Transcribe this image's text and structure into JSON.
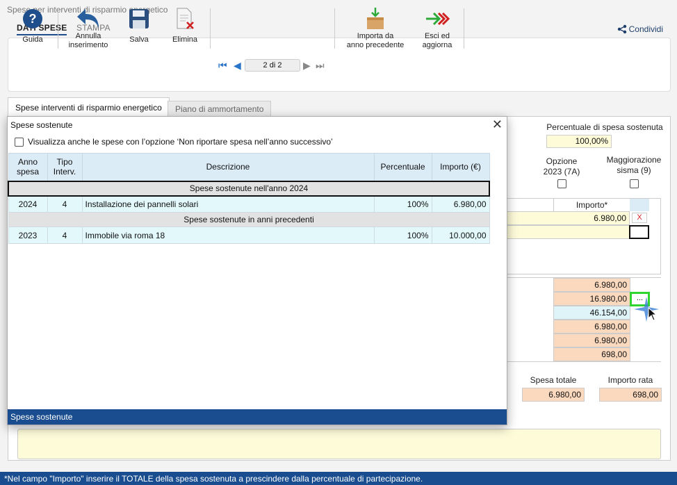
{
  "window_title": "Spese per interventi di risparmio energetico",
  "tabs": {
    "active": "DATI SPESE",
    "inactive": "STAMPA"
  },
  "share_label": "Condividi",
  "toolbar": {
    "guida": "Guida",
    "annulla_1": "Annulla",
    "annulla_2": "inserimento",
    "salva": "Salva",
    "elimina": "Elimina",
    "record_nav": "2 di 2",
    "importa_1": "Importa da",
    "importa_2": "anno precedente",
    "esci_1": "Esci ed",
    "esci_2": "aggiorna"
  },
  "panel_tabs": {
    "active": "Spese interventi di risparmio energetico",
    "inactive": "Piano di ammortamento"
  },
  "right": {
    "perc_label": "Percentuale di spesa sostenuta",
    "perc_value": "100,00%",
    "opzione_1": "Opzione",
    "opzione_2": "2023 (7A)",
    "magg_1": "Maggiorazione",
    "magg_2": "sisma (9)",
    "importo_header": "Importo*",
    "importo_value": "6.980,00",
    "delete_label": "X",
    "dots_label": "...",
    "values": [
      "6.980,00",
      "16.980,00",
      "46.154,00",
      "6.980,00",
      "6.980,00",
      "698,00"
    ],
    "spesa_totale_label": "Spesa totale",
    "spesa_totale_value": "6.980,00",
    "importo_rata_label": "Importo rata",
    "importo_rata_value": "698,00"
  },
  "footer_note": "*Nel campo \"Importo\" inserire il TOTALE della spesa sostenuta a prescindere dalla percentuale di partecipazione.",
  "modal": {
    "title": "Spese sostenute",
    "option_label": "Visualizza anche le spese con l’opzione ‘Non riportare spesa nell’anno successivo’",
    "columns": [
      "Anno spesa",
      "Tipo Interv.",
      "Descrizione",
      "Percentuale",
      "Importo (€)"
    ],
    "group_current": "Spese sostenute nell'anno 2024",
    "row_current": {
      "anno": "2024",
      "tipo": "4",
      "descr": "Installazione dei pannelli solari",
      "perc": "100%",
      "importo": "6.980,00"
    },
    "group_prev": "Spese sostenute in anni precedenti",
    "row_prev": {
      "anno": "2023",
      "tipo": "4",
      "descr": "Immobile via roma 18",
      "perc": "100%",
      "importo": "10.000,00"
    },
    "footer": "Spese sostenute"
  }
}
